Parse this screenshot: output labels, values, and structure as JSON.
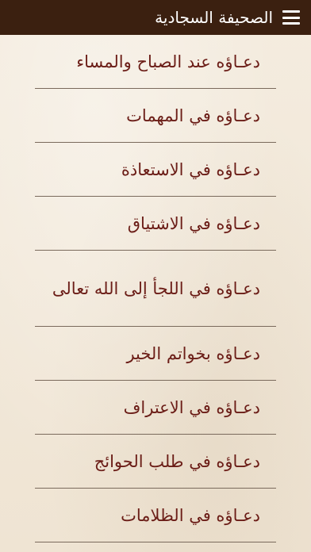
{
  "header": {
    "title": "الصحيفة السجادية"
  },
  "list": {
    "items": [
      {
        "label": "دعـاؤه عند الصباح والمساء"
      },
      {
        "label": "دعـاؤه في المهمات"
      },
      {
        "label": "دعـاؤه في الاستعاذة"
      },
      {
        "label": "دعـاؤه في الاشتياق"
      },
      {
        "label": "دعـاؤه في اللجأ إلى الله تعالى"
      },
      {
        "label": "دعـاؤه بخواتم الخير"
      },
      {
        "label": "دعـاؤه في الاعتراف"
      },
      {
        "label": "دعـاؤه في طلب الحوائج"
      },
      {
        "label": "دعـاؤه في الظلامات"
      }
    ]
  },
  "colors": {
    "header_bg": "#3b2010",
    "item_text": "#6b1d17",
    "divider": "#7a6a5c",
    "background": "#f2e9db"
  },
  "icons": {
    "menu": "hamburger-menu-icon"
  }
}
